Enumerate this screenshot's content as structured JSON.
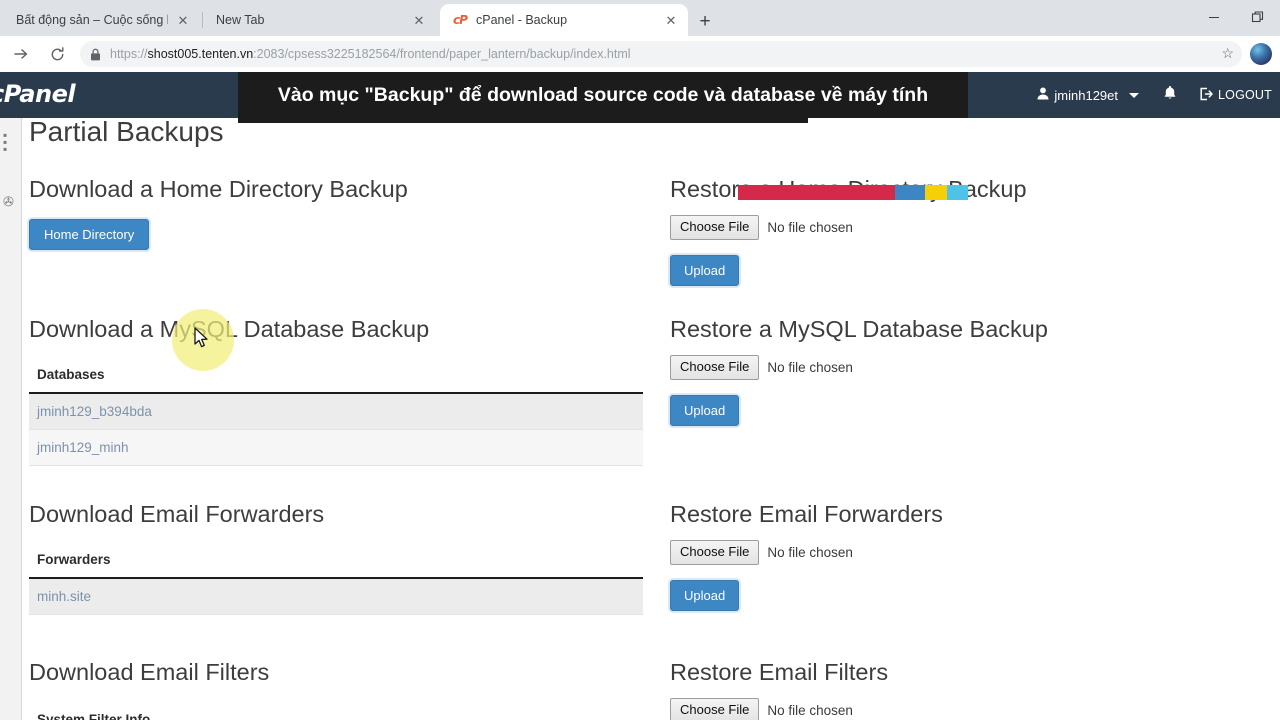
{
  "browser": {
    "tabs": [
      {
        "title": "Bất động sản – Cuộc sống lý tưở",
        "active": false,
        "favicon": ""
      },
      {
        "title": "New Tab",
        "active": false,
        "favicon": ""
      },
      {
        "title": "cPanel - Backup",
        "active": true,
        "favicon": "cp"
      }
    ],
    "close_label": "✕",
    "newtab_label": "+",
    "nav": {
      "forward": "→",
      "reload": "⟳"
    },
    "url": {
      "scheme": "https://",
      "host": "shost005.tenten.vn",
      "path": ":2083/cpsess3225182564/frontend/paper_lantern/backup/index.html"
    },
    "star": "☆",
    "window_controls": {
      "minimize": "—",
      "restore": "❐"
    }
  },
  "cpanel": {
    "logo": "cPanel",
    "banner_text": "Vào mục \"Backup\" để download source code và database về máy tính",
    "user": "jminh129et",
    "bell": "🔔",
    "logout": "LOGOUT",
    "colors": {
      "header_bg": "#2b3b4e",
      "overlay_bg": "#1c1c1c",
      "accent_blue": "#3c87c4",
      "strip_red": "#d4294b",
      "strip_blue": "#3d86c6",
      "strip_yellow": "#f5d008",
      "strip_cyan": "#4ec3e8"
    }
  },
  "page": {
    "title": "Partial Backups",
    "sections": {
      "home_dir": {
        "download_title": "Download a Home Directory Backup",
        "button_label": "Home Directory",
        "restore_title": "Restore a Home Directory Backup",
        "choose_file": "Choose File",
        "no_file": "No file chosen",
        "upload": "Upload"
      },
      "mysql": {
        "download_title": "Download a MySQL Database Backup",
        "table_header": "Databases",
        "rows": [
          "jminh129_b394bda",
          "jminh129_minh"
        ],
        "restore_title": "Restore a MySQL Database Backup",
        "choose_file": "Choose File",
        "no_file": "No file chosen",
        "upload": "Upload"
      },
      "forwarders": {
        "download_title": "Download Email Forwarders",
        "table_header": "Forwarders",
        "rows": [
          "minh.site"
        ],
        "restore_title": "Restore Email Forwarders",
        "choose_file": "Choose File",
        "no_file": "No file chosen",
        "upload": "Upload"
      },
      "filters": {
        "download_title": "Download Email Filters",
        "subhead": "System Filter Info",
        "restore_title": "Restore Email Filters",
        "choose_file": "Choose File",
        "no_file": "No file chosen"
      }
    }
  }
}
